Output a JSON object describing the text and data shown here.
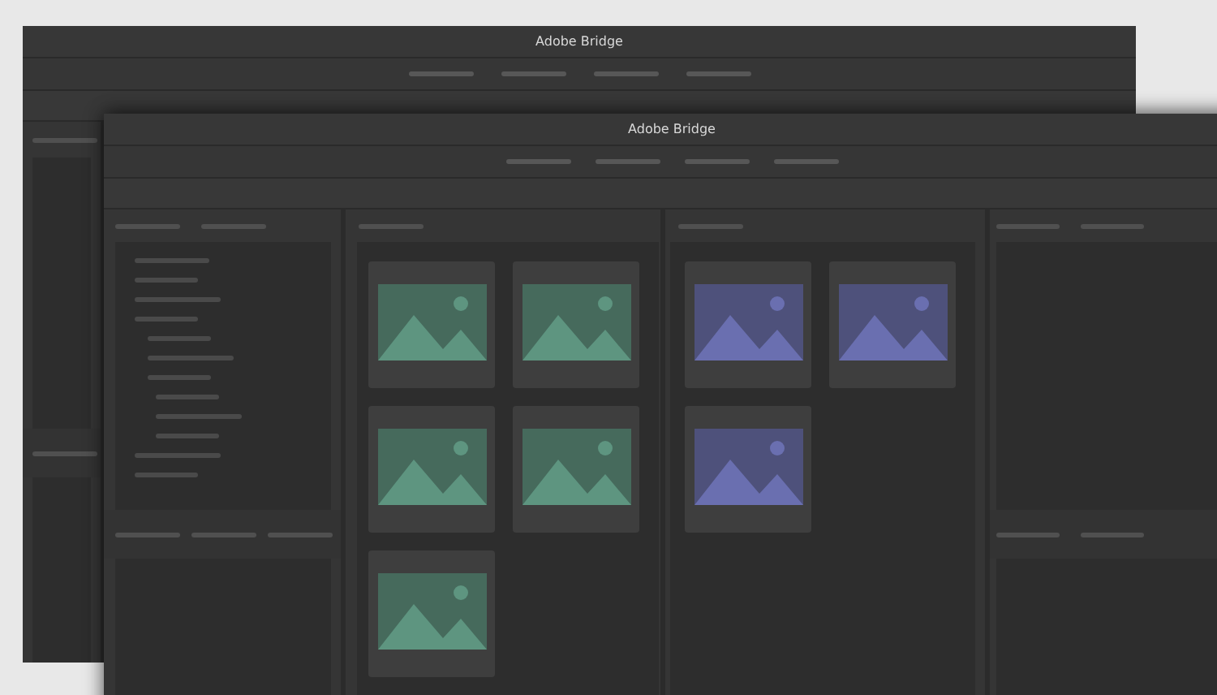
{
  "back_window": {
    "title": "Adobe Bridge"
  },
  "front_window": {
    "title": "Adobe Bridge",
    "content_panels": [
      {
        "thumbnails": [
          {
            "color": "#5e9580"
          },
          {
            "color": "#5e9580"
          },
          {
            "color": "#5e9580"
          },
          {
            "color": "#5e9580"
          },
          {
            "color": "#5e9580"
          }
        ]
      },
      {
        "thumbnails": [
          {
            "color": "#6a6fb0"
          },
          {
            "color": "#6a6fb0"
          },
          {
            "color": "#6a6fb0"
          }
        ]
      }
    ]
  }
}
